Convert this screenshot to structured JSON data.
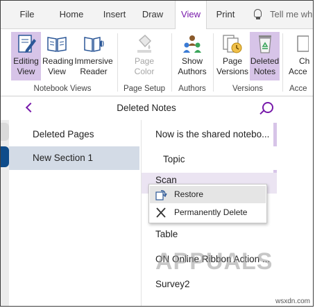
{
  "tabs": [
    {
      "label": "File",
      "active": false
    },
    {
      "label": "Home",
      "active": false
    },
    {
      "label": "Insert",
      "active": false
    },
    {
      "label": "Draw",
      "active": false
    },
    {
      "label": "View",
      "active": true
    },
    {
      "label": "Print",
      "active": false
    }
  ],
  "tell_me": "Tell me wh",
  "ribbon": {
    "buttons": [
      {
        "label1": "Editing",
        "label2": "View",
        "icon": "editing-view-icon",
        "state": "selected"
      },
      {
        "label1": "Reading",
        "label2": "View",
        "icon": "reading-view-icon",
        "state": "normal"
      },
      {
        "label1": "Immersive",
        "label2": "Reader",
        "icon": "immersive-reader-icon",
        "state": "normal"
      },
      {
        "label1": "Page",
        "label2": "Color",
        "icon": "page-color-icon",
        "state": "disabled"
      },
      {
        "label1": "Show",
        "label2": "Authors",
        "icon": "show-authors-icon",
        "state": "normal"
      },
      {
        "label1": "Page",
        "label2": "Versions",
        "icon": "page-versions-icon",
        "state": "normal"
      },
      {
        "label1": "Deleted",
        "label2": "Notes",
        "icon": "recycle-bin-icon",
        "state": "selected"
      },
      {
        "label1": "Ch",
        "label2": "Acce",
        "icon": "check-accessibility-icon",
        "state": "normal"
      }
    ],
    "groups": [
      "Notebook Views",
      "Page Setup",
      "Authors",
      "Versions",
      "Acce"
    ]
  },
  "header": {
    "title": "Deleted Notes"
  },
  "sections": [
    {
      "label": "Deleted Pages",
      "selected": false
    },
    {
      "label": "New Section 1",
      "selected": true
    }
  ],
  "pages": [
    {
      "label": "Now is the shared notebo...",
      "sub": false
    },
    {
      "label": "Topic",
      "sub": true
    },
    {
      "label": "Scan",
      "sub": false
    },
    {
      "label": "Table",
      "sub": false
    },
    {
      "label": "ON Online Ribbon Action ...",
      "sub": false
    },
    {
      "label": "Survey2",
      "sub": false
    }
  ],
  "context_menu": [
    {
      "label": "Restore",
      "icon": "restore-icon"
    },
    {
      "label": "Permanently Delete",
      "icon": "delete-x-icon"
    }
  ],
  "watermark": "APPUALS",
  "site": "wsxdn.com",
  "colors": {
    "accent": "#7719aa",
    "selected_button": "#d7c4e8",
    "section_selected": "#d3dbe6",
    "section_tab": "#0f4c8a"
  }
}
